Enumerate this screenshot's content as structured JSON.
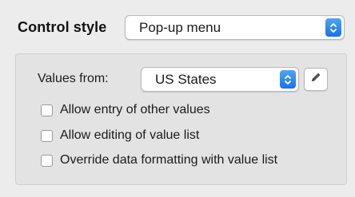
{
  "control_style": {
    "label": "Control style",
    "selected": "Pop-up menu"
  },
  "values_from": {
    "label": "Values from:",
    "selected": "US States"
  },
  "edit_button_icon": "pencil-icon",
  "checkboxes": [
    {
      "label": "Allow entry of other values",
      "checked": false
    },
    {
      "label": "Allow editing of value list",
      "checked": false
    },
    {
      "label": "Override data formatting with value list",
      "checked": false
    }
  ],
  "colors": {
    "accent": "#1a72e8",
    "panel_background": "#ececec",
    "group_background": "#e3e3e3"
  }
}
